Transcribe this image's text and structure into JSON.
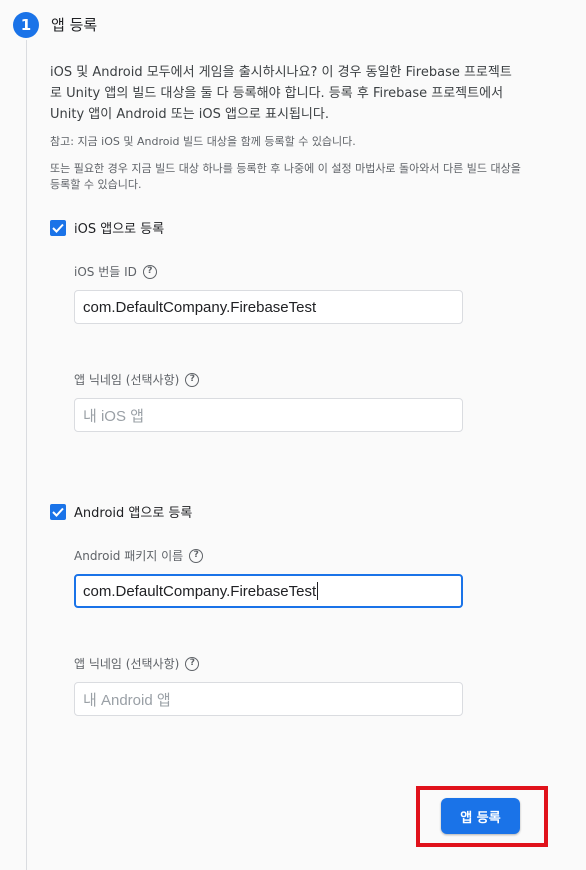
{
  "step": {
    "number": "1",
    "title": "앱 등록"
  },
  "description": "iOS 및 Android 모두에서 게임을 출시하시나요? 이 경우 동일한 Firebase 프로젝트로 Unity 앱의 빌드 대상을 둘 다 등록해야 합니다. 등록 후 Firebase 프로젝트에서 Unity 앱이 Android 또는 iOS 앱으로 표시됩니다.",
  "notes": {
    "note1": "참고: 지금 iOS 및 Android 빌드 대상을 함께 등록할 수 있습니다.",
    "note2": "또는 필요한 경우 지금 빌드 대상 하나를 등록한 후 나중에 이 설정 마법사로 돌아와서 다른 빌드 대상을 등록할 수 있습니다."
  },
  "ios": {
    "checkbox_label": "iOS 앱으로 등록",
    "checked": true,
    "bundle_label": "iOS 번들 ID",
    "bundle_value": "com.DefaultCompany.FirebaseTest",
    "nickname_label": "앱 닉네임 (선택사항)",
    "nickname_placeholder": "내 iOS 앱"
  },
  "android": {
    "checkbox_label": "Android 앱으로 등록",
    "checked": true,
    "package_label": "Android 패키지 이름",
    "package_value": "com.DefaultCompany.FirebaseTest",
    "nickname_label": "앱 닉네임 (선택사항)",
    "nickname_placeholder": "내 Android 앱"
  },
  "register_button": "앱 등록",
  "colors": {
    "accent": "#1a73e8",
    "highlight": "#e0121b"
  },
  "icons": {
    "checkbox": "check-icon",
    "help": "help-circle-icon"
  }
}
